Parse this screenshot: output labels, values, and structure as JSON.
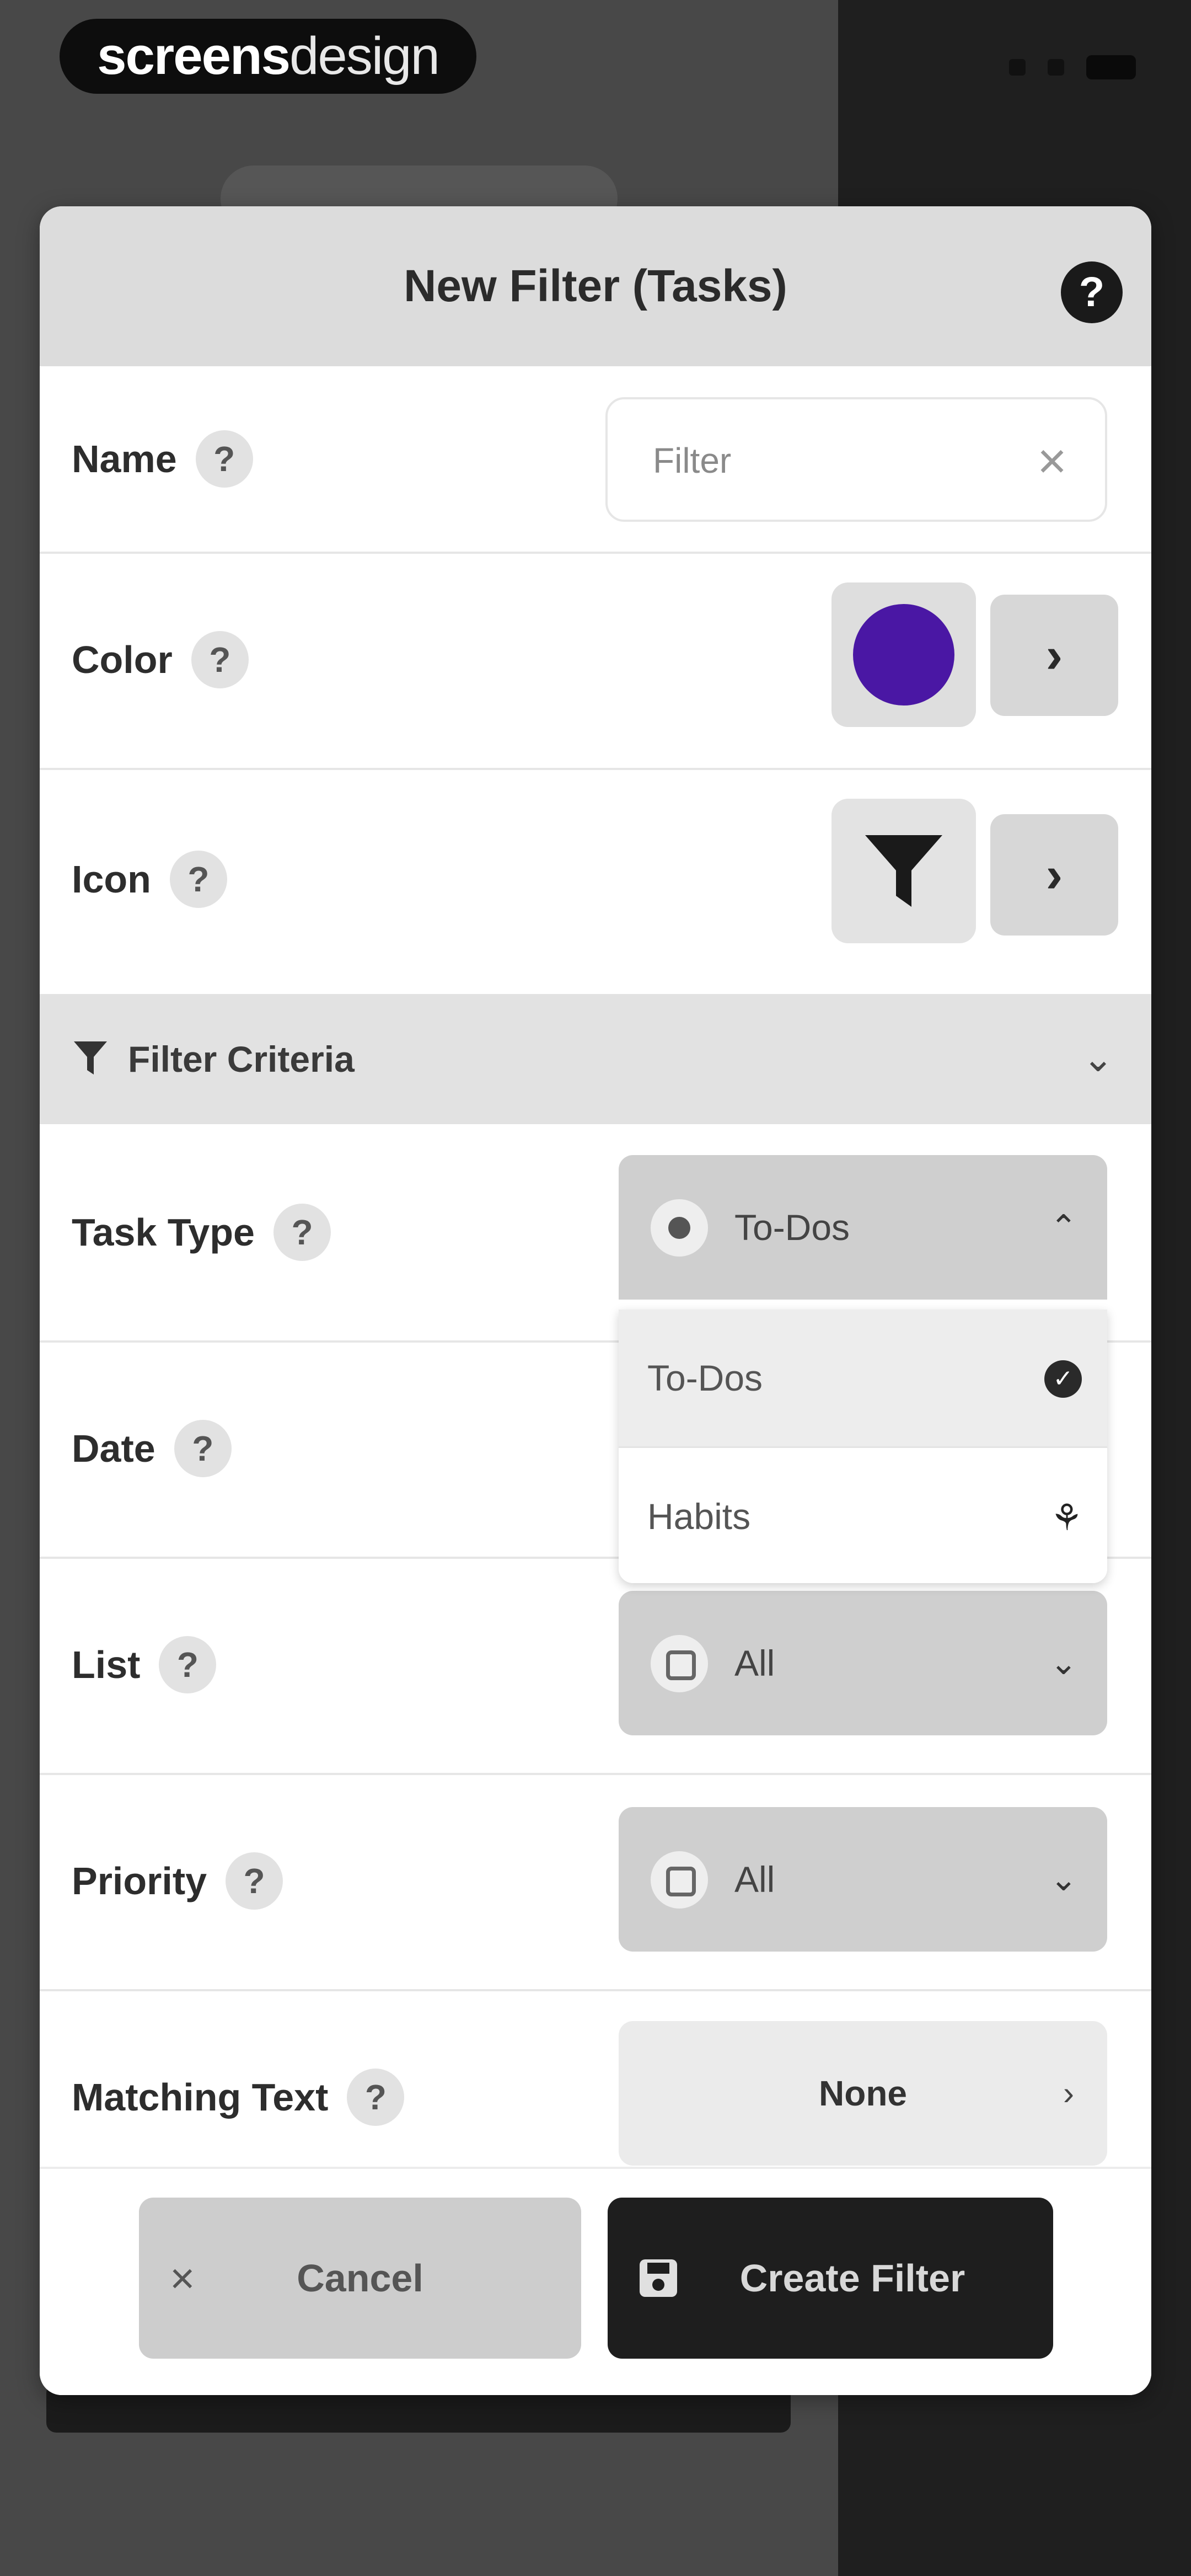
{
  "watermark": {
    "bold": "screens",
    "light": "design"
  },
  "modal": {
    "title": "New Filter (Tasks)",
    "help": "?"
  },
  "fields": {
    "name": {
      "label": "Name",
      "placeholder": "Filter",
      "value": ""
    },
    "color": {
      "label": "Color",
      "value_hex": "#4a17a4"
    },
    "icon": {
      "label": "Icon",
      "value_icon": "funnel-icon"
    }
  },
  "section": {
    "label": "Filter Criteria"
  },
  "criteria": {
    "task_type": {
      "label": "Task Type",
      "value": "To-Dos",
      "options": [
        {
          "label": "To-Dos",
          "icon": "check-circle-icon",
          "selected": true
        },
        {
          "label": "Habits",
          "icon": "sprout-icon",
          "selected": false
        }
      ]
    },
    "date": {
      "label": "Date"
    },
    "list": {
      "label": "List",
      "value": "All"
    },
    "priority": {
      "label": "Priority",
      "value": "All"
    },
    "matching_text": {
      "label": "Matching Text",
      "value": "None"
    }
  },
  "footer": {
    "cancel": "Cancel",
    "create": "Create Filter"
  },
  "colors": {
    "accent_purple": "#4a17a4",
    "primary_button": "#1e1e1e",
    "secondary_button": "#cdcdcd"
  }
}
